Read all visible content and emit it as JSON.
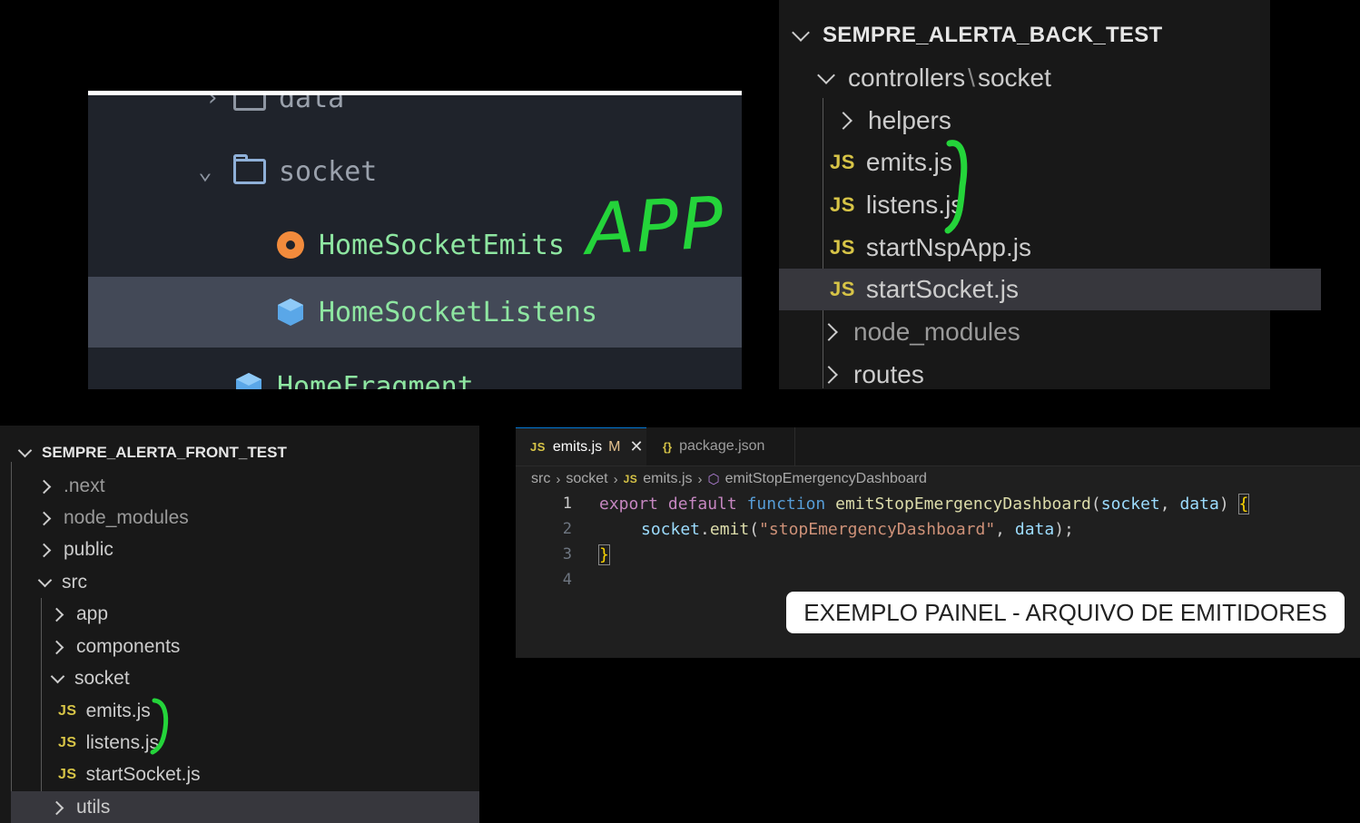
{
  "app_panel": {
    "annotation": "APP",
    "items": [
      {
        "label": "data"
      },
      {
        "label": "socket"
      },
      {
        "label": "HomeSocketEmits"
      },
      {
        "label": "HomeSocketListens"
      },
      {
        "label": "HomeFragment"
      }
    ]
  },
  "back_explorer": {
    "root": "SEMPRE_ALERTA_BACK_TEST",
    "folder_path": "controllers",
    "folder_sep": "\\",
    "folder_child": "socket",
    "items": [
      {
        "label": "helpers"
      },
      {
        "label": "emits.js",
        "badge": "JS"
      },
      {
        "label": "listens.js",
        "badge": "JS"
      },
      {
        "label": "startNspApp.js",
        "badge": "JS"
      },
      {
        "label": "startSocket.js",
        "badge": "JS"
      },
      {
        "label": "node_modules"
      },
      {
        "label": "routes"
      }
    ]
  },
  "front_explorer": {
    "root": "SEMPRE_ALERTA_FRONT_TEST",
    "items": [
      {
        "label": ".next"
      },
      {
        "label": "node_modules"
      },
      {
        "label": "public"
      },
      {
        "label": "src"
      },
      {
        "label": "app"
      },
      {
        "label": "components"
      },
      {
        "label": "socket"
      },
      {
        "label": "emits.js",
        "badge": "JS"
      },
      {
        "label": "listens.js",
        "badge": "JS"
      },
      {
        "label": "startSocket.js",
        "badge": "JS"
      },
      {
        "label": "utils"
      }
    ]
  },
  "editor": {
    "tabs": [
      {
        "label": "emits.js",
        "badge": "JS",
        "modified": "M",
        "close": "✕"
      },
      {
        "label": "package.json",
        "badge": "{}"
      }
    ],
    "breadcrumb": [
      "src",
      "socket",
      "emits.js",
      "emitStopEmergencyDashboard"
    ],
    "breadcrumb_badge": "JS",
    "line_numbers": [
      "1",
      "2",
      "3",
      "4"
    ],
    "code": {
      "l1_export": "export",
      "l1_default": "default",
      "l1_function": "function",
      "l1_name": "emitStopEmergencyDashboard",
      "l1_open": "(",
      "l1_p1": "socket",
      "l1_comma": ", ",
      "l1_p2": "data",
      "l1_close": ") ",
      "l1_brace": "{",
      "l2_obj": "socket",
      "l2_dot": ".",
      "l2_method": "emit",
      "l2_open": "(",
      "l2_str": "\"stopEmergencyDashboard\"",
      "l2_comma": ", ",
      "l2_arg": "data",
      "l2_end": ");",
      "l3_brace": "}"
    },
    "callout": "EXEMPLO PAINEL - ARQUIVO DE EMITIDORES"
  },
  "colors": {
    "annotation_green": "#24d43a",
    "js_badge": "#d7c447",
    "app_file_green": "#8ee6a1"
  }
}
